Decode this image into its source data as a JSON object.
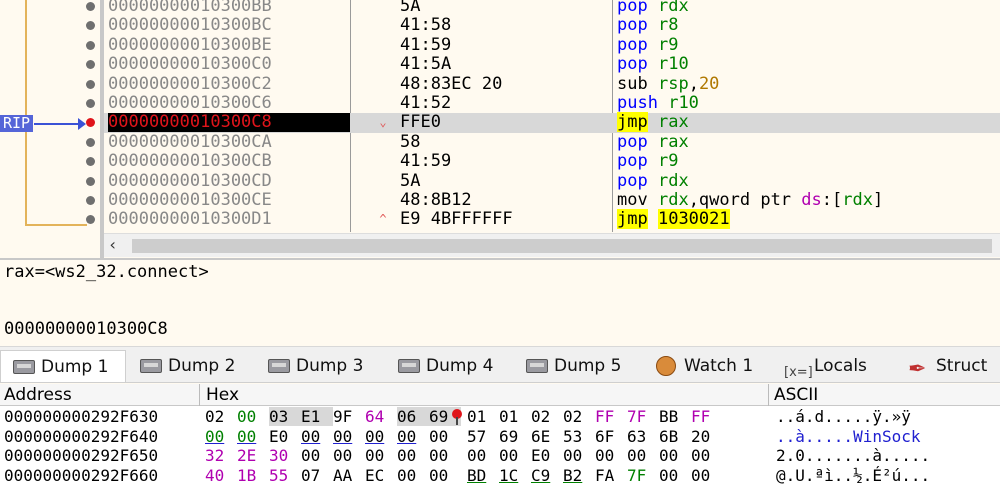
{
  "disassembly": {
    "rip_label": "RIP",
    "rows": [
      {
        "addr": "00000000010300BB",
        "bytes": "5A",
        "op": "pop",
        "args": [
          {
            "t": "reg",
            "v": "rdx"
          }
        ],
        "mark": ""
      },
      {
        "addr": "00000000010300BC",
        "bytes": "41:58",
        "op": "pop",
        "args": [
          {
            "t": "reg",
            "v": "r8"
          }
        ],
        "mark": ""
      },
      {
        "addr": "00000000010300BE",
        "bytes": "41:59",
        "op": "pop",
        "args": [
          {
            "t": "reg",
            "v": "r9"
          }
        ],
        "mark": ""
      },
      {
        "addr": "00000000010300C0",
        "bytes": "41:5A",
        "op": "pop",
        "args": [
          {
            "t": "reg",
            "v": "r10"
          }
        ],
        "mark": ""
      },
      {
        "addr": "00000000010300C2",
        "bytes": "48:83EC 20",
        "op": "sub",
        "args": [
          {
            "t": "reg",
            "v": "rsp"
          },
          {
            "t": "punct",
            "v": ","
          },
          {
            "t": "num",
            "v": "20"
          }
        ],
        "mark": ""
      },
      {
        "addr": "00000000010300C6",
        "bytes": "41:52",
        "op": "push",
        "args": [
          {
            "t": "reg",
            "v": "r10"
          }
        ],
        "mark": ""
      },
      {
        "addr": "00000000010300C8",
        "bytes": "FFE0",
        "op": "jmp",
        "args": [
          {
            "t": "reg",
            "v": "rax"
          }
        ],
        "mark": "⌄",
        "current": true
      },
      {
        "addr": "00000000010300CA",
        "bytes": "58",
        "op": "pop",
        "args": [
          {
            "t": "reg",
            "v": "rax"
          }
        ],
        "mark": ""
      },
      {
        "addr": "00000000010300CB",
        "bytes": "41:59",
        "op": "pop",
        "args": [
          {
            "t": "reg",
            "v": "r9"
          }
        ],
        "mark": ""
      },
      {
        "addr": "00000000010300CD",
        "bytes": "5A",
        "op": "pop",
        "args": [
          {
            "t": "reg",
            "v": "rdx"
          }
        ],
        "mark": ""
      },
      {
        "addr": "00000000010300CE",
        "bytes": "48:8B12",
        "op": "mov",
        "args": [
          {
            "t": "reg",
            "v": "rdx"
          },
          {
            "t": "punct",
            "v": ",qword ptr "
          },
          {
            "t": "seg",
            "v": "ds"
          },
          {
            "t": "punct",
            "v": ":["
          },
          {
            "t": "reg",
            "v": "rdx"
          },
          {
            "t": "punct",
            "v": "]"
          }
        ],
        "mark": ""
      },
      {
        "addr": "00000000010300D1",
        "bytes": "E9 4BFFFFFF",
        "op": "jmp",
        "args": [
          {
            "t": "jmptarget",
            "v": "1030021"
          }
        ],
        "mark": "^"
      }
    ]
  },
  "info": {
    "line1": "rax=<ws2_32.connect>",
    "line2": "00000000010300C8"
  },
  "tabs": [
    {
      "label": "Dump 1",
      "icon": "memory-icon",
      "active": true
    },
    {
      "label": "Dump 2",
      "icon": "memory-icon"
    },
    {
      "label": "Dump 3",
      "icon": "memory-icon"
    },
    {
      "label": "Dump 4",
      "icon": "memory-icon"
    },
    {
      "label": "Dump 5",
      "icon": "memory-icon"
    },
    {
      "label": "Watch 1",
      "icon": "watch-icon"
    },
    {
      "label": "Locals",
      "icon": "locals-icon",
      "icon_text": "[x=]"
    },
    {
      "label": "Struct",
      "icon": "struct-icon"
    }
  ],
  "dump": {
    "headers": {
      "address": "Address",
      "hex": "Hex",
      "ascii": "ASCII"
    },
    "rows": [
      {
        "addr": "000000000292F630",
        "hex": [
          "02",
          "00",
          "03",
          "E1",
          "9F",
          "64",
          "06",
          "69",
          "01",
          "01",
          "02",
          "02",
          "FF",
          "7F",
          "BB",
          "FF"
        ],
        "ascii": "..á.d.....ÿ.»ÿ"
      },
      {
        "addr": "000000000292F640",
        "hex": [
          "00",
          "00",
          "E0",
          "00",
          "00",
          "00",
          "00",
          "00",
          "57",
          "69",
          "6E",
          "53",
          "6F",
          "63",
          "6B",
          "20"
        ],
        "ascii": "..à.....WinSock "
      },
      {
        "addr": "000000000292F650",
        "hex": [
          "32",
          "2E",
          "30",
          "00",
          "00",
          "00",
          "00",
          "00",
          "00",
          "00",
          "E0",
          "00",
          "00",
          "00",
          "00",
          "00"
        ],
        "ascii": "2.0.......à....."
      },
      {
        "addr": "000000000292F660",
        "hex": [
          "40",
          "1B",
          "55",
          "07",
          "AA",
          "EC",
          "00",
          "00",
          "BD",
          "1C",
          "C9",
          "B2",
          "FA",
          "7F",
          "00",
          "00"
        ],
        "ascii": "@.U.ªì..½.É²ú..."
      }
    ]
  },
  "colors": {
    "rip_marker": "#5565d8",
    "breakpoint_red": "#e0141a",
    "jmp_highlight": "#ffff00"
  }
}
